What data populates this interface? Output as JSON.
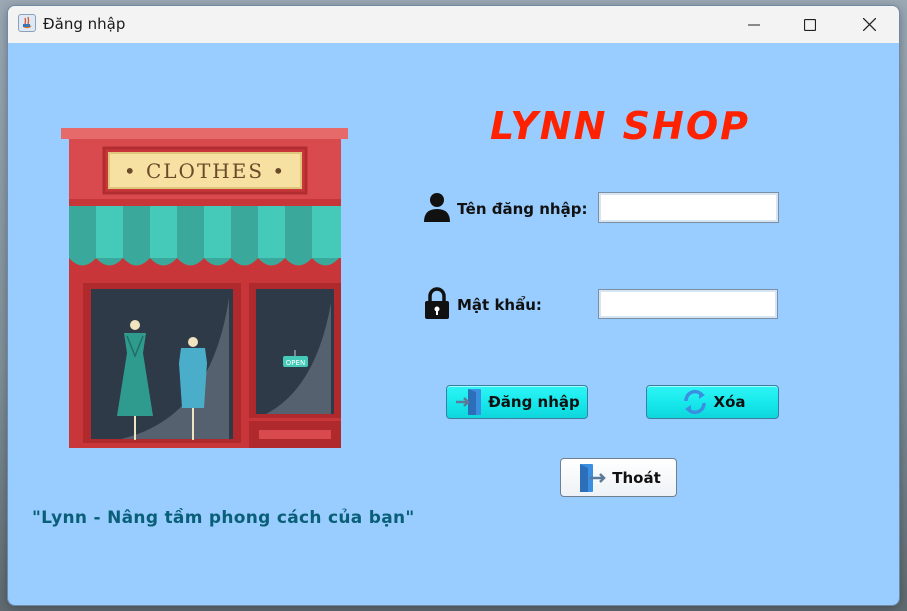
{
  "window": {
    "title": "Đăng nhập",
    "controls": [
      "minimize-icon",
      "maximize-icon",
      "close-icon"
    ]
  },
  "illustration": {
    "sign_text": "• CLOTHES •",
    "open_tag": "OPEN"
  },
  "brand": {
    "logo": "LYNN SHOP",
    "color": "#ff2200"
  },
  "form": {
    "username": {
      "label": "Tên đăng nhập:",
      "value": "",
      "icon": "user-icon"
    },
    "password": {
      "label": "Mật khẩu:",
      "value": "",
      "icon": "lock-icon"
    }
  },
  "buttons": {
    "login": {
      "label": "Đăng nhập",
      "icon": "enter-door-icon"
    },
    "clear": {
      "label": "Xóa",
      "icon": "refresh-icon"
    },
    "exit": {
      "label": "Thoát",
      "icon": "exit-door-icon"
    }
  },
  "slogan": "\"Lynn - Nâng tầm phong cách của bạn\"",
  "colors": {
    "background": "#99ccff",
    "button_cyan": "#14e6ea",
    "slogan": "#0a5f78"
  }
}
